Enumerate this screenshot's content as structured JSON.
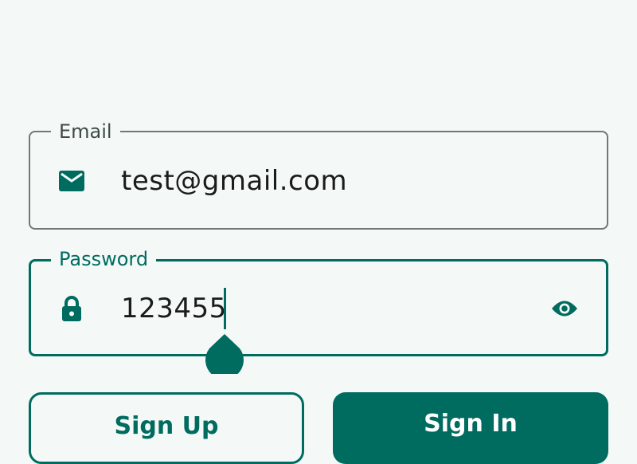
{
  "email_field": {
    "label": "Email",
    "value": "test@gmail.com",
    "icon": "mail-icon"
  },
  "password_field": {
    "label": "Password",
    "value": "123455",
    "icon": "lock-icon",
    "trailing_icon": "eye-icon"
  },
  "buttons": {
    "signup_label": "Sign Up",
    "signin_label": "Sign In"
  },
  "colors": {
    "primary": "#006b5f",
    "background": "#f4f9f7",
    "outline": "#6f7976",
    "text": "#191c1b"
  }
}
